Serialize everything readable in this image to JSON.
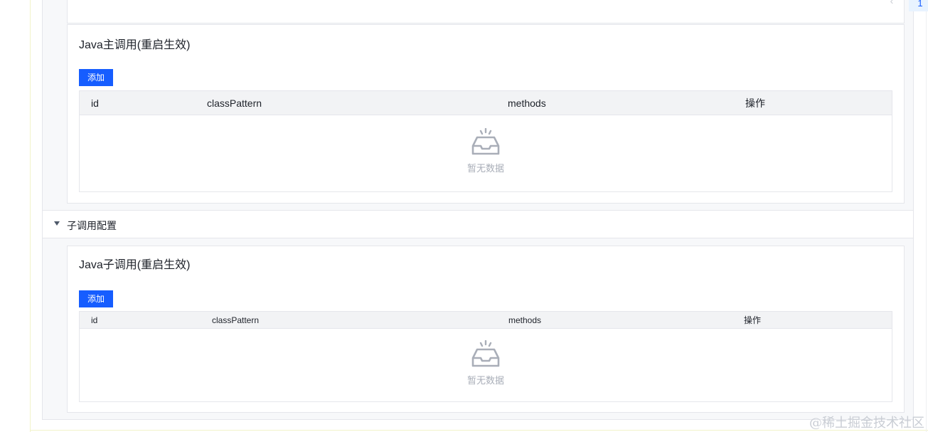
{
  "pagination": {
    "prev": "‹",
    "current_page": "1",
    "next": "›"
  },
  "main_call": {
    "title": "Java主调用(重启生效)",
    "add_label": "添加",
    "columns": [
      "id",
      "classPattern",
      "methods",
      "操作"
    ],
    "empty_text": "暂无数据"
  },
  "sub_section": {
    "title": "子调用配置",
    "expanded": true
  },
  "sub_call": {
    "title": "Java子调用(重启生效)",
    "add_label": "添加",
    "columns": [
      "id",
      "classPattern",
      "methods",
      "操作"
    ],
    "empty_text": "暂无数据"
  },
  "watermark": "@稀土掘金技术社区",
  "colors": {
    "primary": "#165dff",
    "header_bg": "#f2f3f5",
    "empty_text": "#a9aeb8"
  }
}
